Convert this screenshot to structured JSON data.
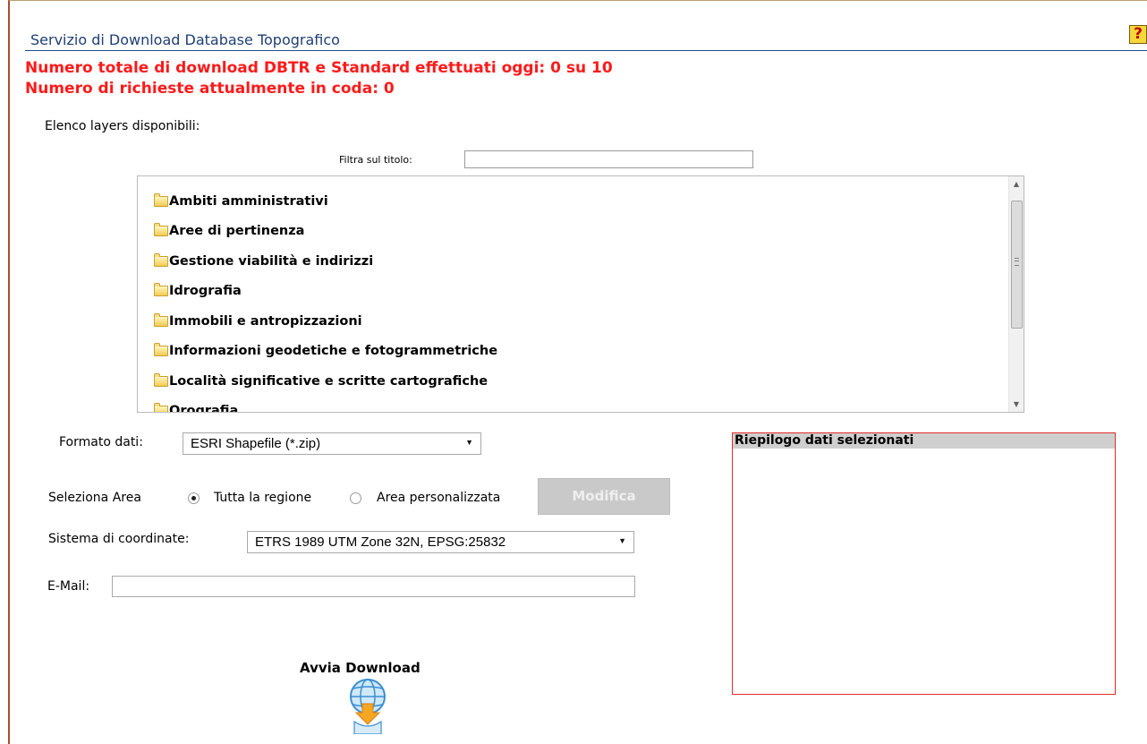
{
  "header": {
    "title": "Servizio di Download Database Topografico",
    "help_glyph": "?"
  },
  "status": {
    "downloads_today": "Numero totale di download DBTR e Standard effettuati oggi: 0 su 10",
    "queue": "Numero di richieste attualmente in coda: 0"
  },
  "layers": {
    "heading": "Elenco layers disponibili:",
    "filter_label": "Filtra sul titolo:",
    "filter_value": "",
    "items": [
      {
        "label": "Ambiti amministrativi",
        "icon": "folder-icon"
      },
      {
        "label": "Aree di pertinenza",
        "icon": "folder-icon"
      },
      {
        "label": "Gestione viabilità e indirizzi",
        "icon": "folder-icon"
      },
      {
        "label": "Idrografia",
        "icon": "folder-icon"
      },
      {
        "label": "Immobili e antropizzazioni",
        "icon": "folder-icon"
      },
      {
        "label": "Informazioni geodetiche e fotogrammetriche",
        "icon": "folder-icon"
      },
      {
        "label": "Località significative e scritte cartografiche",
        "icon": "folder-icon"
      },
      {
        "label": "Orografia",
        "icon": "folder-icon"
      }
    ]
  },
  "form": {
    "format_label": "Formato dati:",
    "format_value": "ESRI Shapefile (*.zip)",
    "area_label": "Seleziona Area",
    "area_option_all": "Tutta la regione",
    "area_option_custom": "Area personalizzata",
    "area_selected": "all",
    "modify_label": "Modifica",
    "crs_label": "Sistema di coordinate:",
    "crs_value": "ETRS 1989 UTM Zone 32N, EPSG:25832",
    "email_label": "E-Mail:",
    "email_value": ""
  },
  "download": {
    "label": "Avvia Download",
    "icon": "globe-download-icon"
  },
  "summary": {
    "title": "Riepilogo dati selezionati"
  },
  "colors": {
    "status_red": "#ff1a1a",
    "title_blue": "#1f3f73",
    "summary_border": "#e02a2a",
    "frame_brown": "#a0522d"
  }
}
